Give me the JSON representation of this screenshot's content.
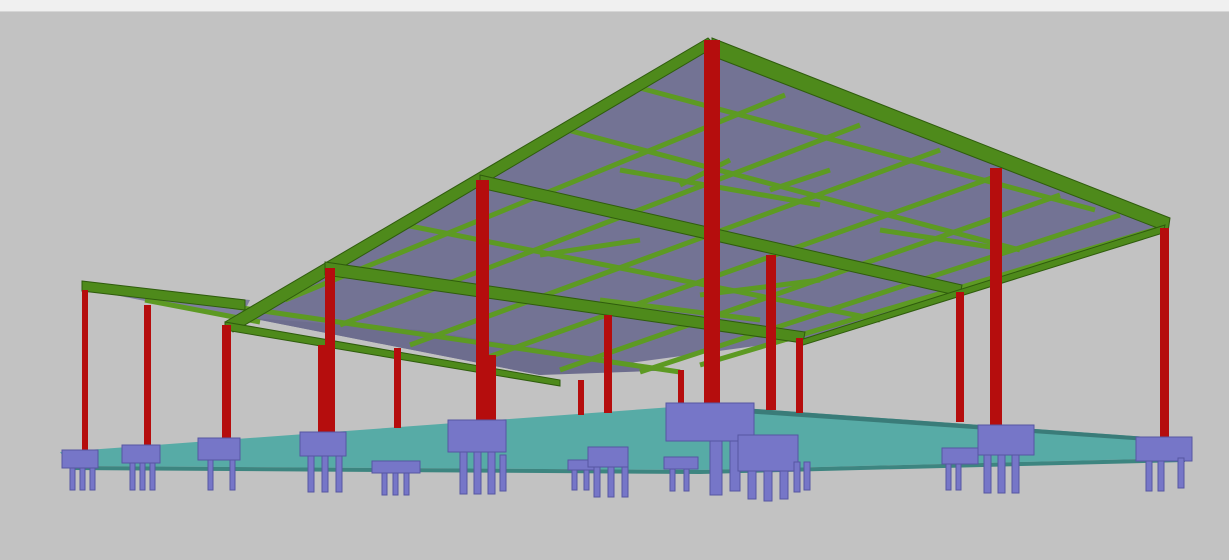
{
  "window": {
    "title": ""
  },
  "viewport": {
    "view_mode": "3D perspective",
    "background": "#c2c2c2"
  },
  "colors": {
    "steel_beam": "#4e8a1b",
    "steel_beam_dark": "#2f5c0d",
    "column": "#b50d0d",
    "column_dark": "#7e0606",
    "deck": "#727294",
    "ground_slab": "#4fa39f",
    "ground_slab_dark": "#3a7c79",
    "foundation": "#7676c8",
    "foundation_dark": "#5656a2"
  },
  "model": {
    "elements": [
      "roof-deck",
      "primary-beams",
      "secondary-beams",
      "columns",
      "ground-slab",
      "pile-caps",
      "piles"
    ]
  }
}
